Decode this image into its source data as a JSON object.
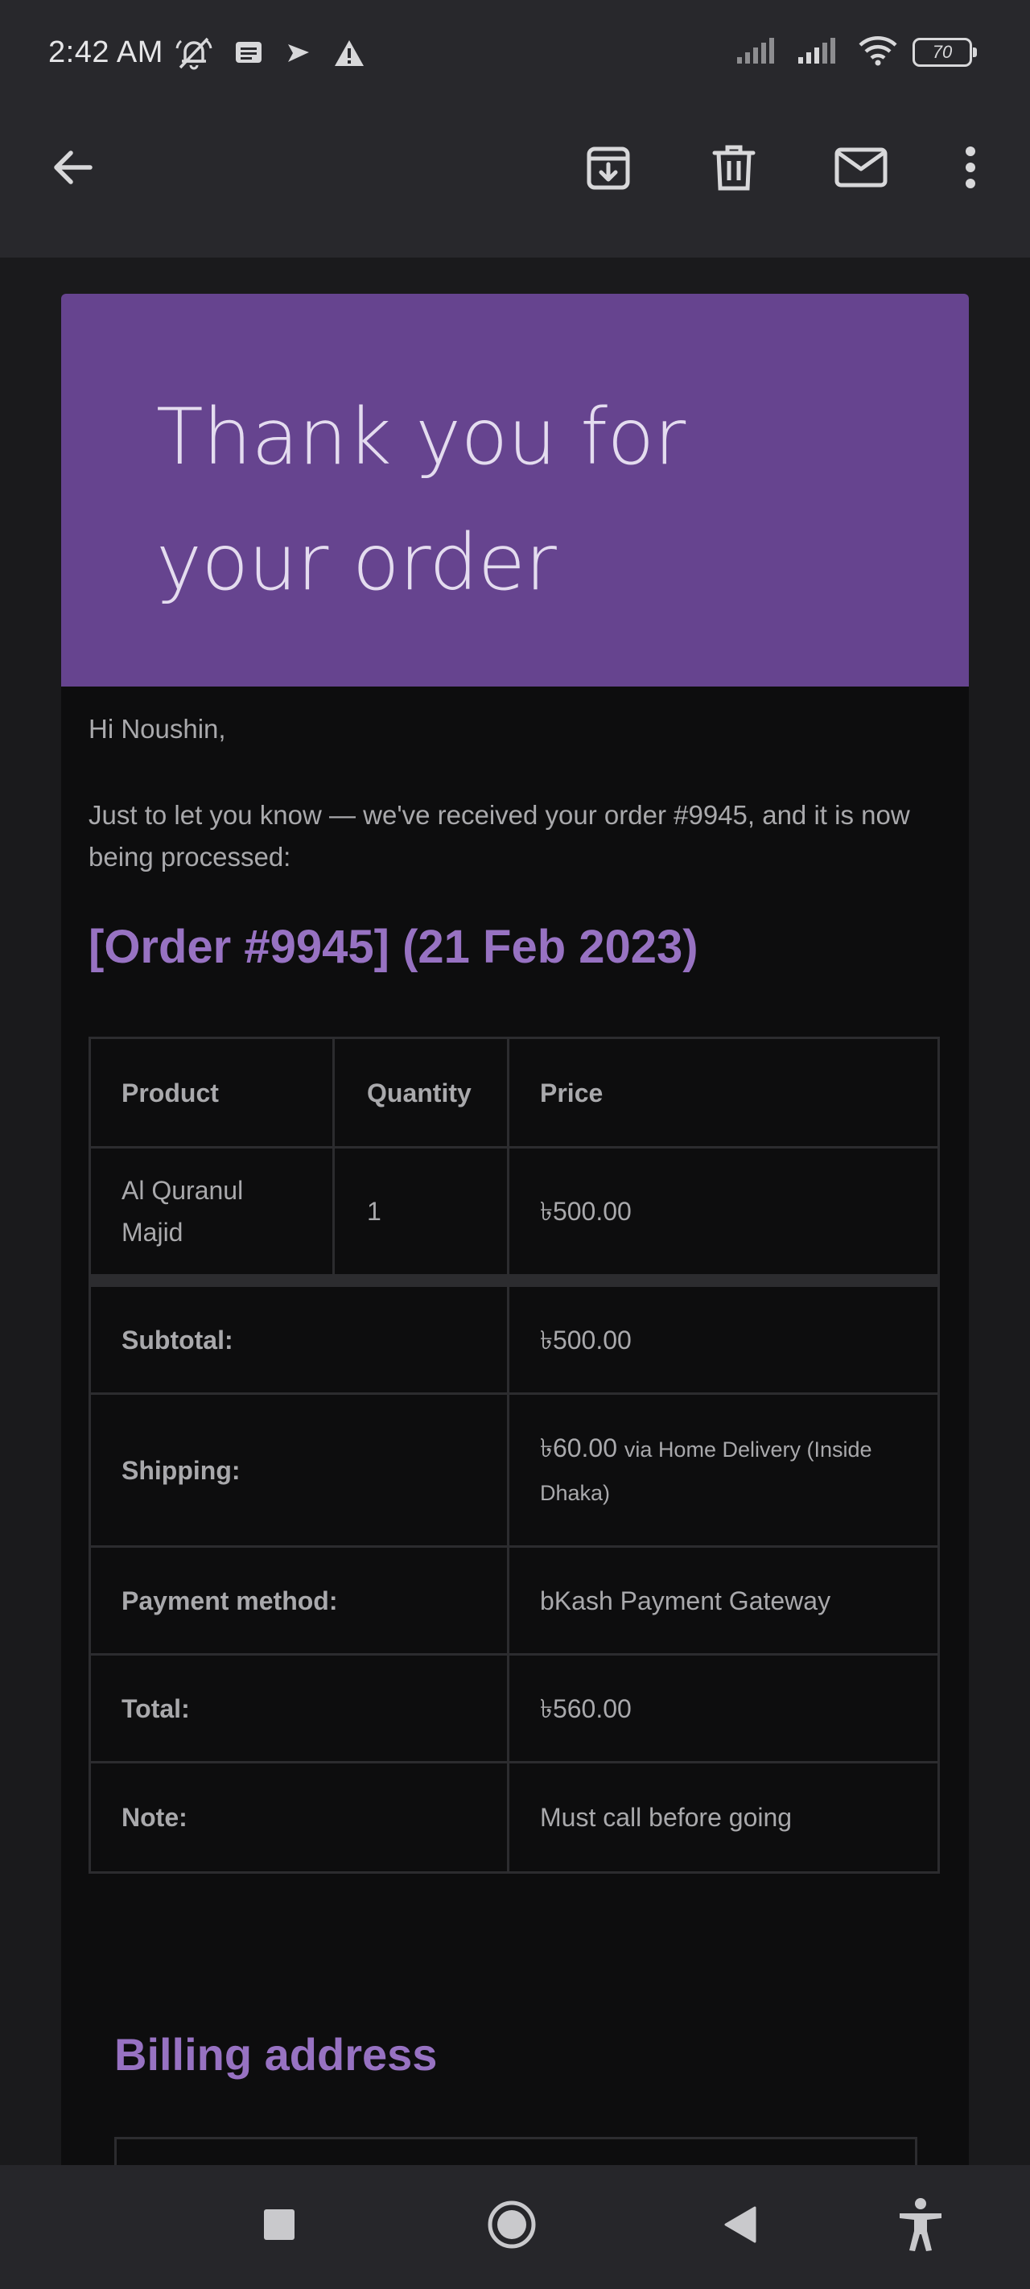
{
  "status_bar": {
    "time": "2:42 AM",
    "battery": "70",
    "icons": [
      "notifications-muted-icon",
      "message-icon",
      "location-arrow-icon",
      "warning-icon",
      "signal-icon",
      "signal-icon",
      "wifi-icon",
      "battery-icon"
    ]
  },
  "toolbar": {
    "icons": [
      "back-arrow-icon",
      "archive-icon",
      "delete-icon",
      "mark-unread-icon",
      "more-vert-icon"
    ]
  },
  "email": {
    "hero_title": "Thank you for your order",
    "hero_color": "#66448f",
    "greeting": "Hi Noushin,",
    "intro": "Just to let you know — we've received your order #9945, and it is now being processed:",
    "order_heading": "[Order #9945] (21 Feb 2023)",
    "accent_color": "#9772c2",
    "table": {
      "headers": [
        "Product",
        "Quantity",
        "Price"
      ],
      "items": [
        {
          "product": "Al Quranul Majid",
          "quantity": "1",
          "price": "৳500.00"
        }
      ],
      "totals": [
        {
          "label": "Subtotal:",
          "value": "৳500.00"
        },
        {
          "label": "Shipping:",
          "value": "৳60.00",
          "note": "via Home Delivery (Inside Dhaka)"
        },
        {
          "label": "Payment method:",
          "value": "bKash Payment Gateway"
        },
        {
          "label": "Total:",
          "value": "৳560.00"
        },
        {
          "label": "Note:",
          "value": "Must call before going"
        }
      ]
    },
    "billing_heading": "Billing address"
  },
  "nav_bar": {
    "icons": [
      "recents-square-icon",
      "home-circle-icon",
      "back-triangle-icon",
      "accessibility-icon"
    ]
  }
}
